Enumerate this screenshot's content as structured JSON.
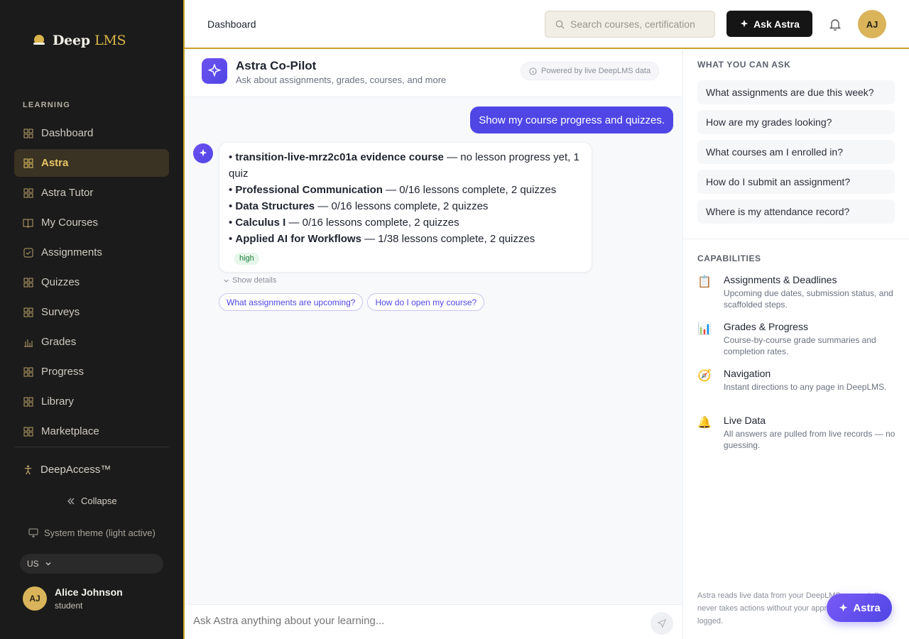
{
  "brand": {
    "name_prefix": "Deep",
    "name_suffix": "LMS"
  },
  "sidebar": {
    "section_label": "LEARNING",
    "items": [
      {
        "label": "Dashboard",
        "icon": "grid-icon",
        "active": false
      },
      {
        "label": "Astra",
        "icon": "grid-icon",
        "active": true
      },
      {
        "label": "Astra Tutor",
        "icon": "grid-icon",
        "active": false
      },
      {
        "label": "My Courses",
        "icon": "book-icon",
        "active": false
      },
      {
        "label": "Assignments",
        "icon": "check-square-icon",
        "active": false
      },
      {
        "label": "Quizzes",
        "icon": "grid-icon",
        "active": false
      },
      {
        "label": "Surveys",
        "icon": "grid-icon",
        "active": false
      },
      {
        "label": "Grades",
        "icon": "bar-chart-icon",
        "active": false
      },
      {
        "label": "Progress",
        "icon": "grid-icon",
        "active": false
      },
      {
        "label": "Library",
        "icon": "grid-icon",
        "active": false
      },
      {
        "label": "Marketplace",
        "icon": "grid-icon",
        "active": false
      }
    ],
    "deepaccess": "DeepAccess™",
    "collapse": "Collapse",
    "theme": "System theme (light active)",
    "locale": "US",
    "user": {
      "initials": "AJ",
      "name": "Alice Johnson",
      "role": "student"
    }
  },
  "topbar": {
    "breadcrumb": "Dashboard",
    "search_placeholder": "Search courses, certification",
    "ask_button": "Ask Astra",
    "user_initials": "AJ"
  },
  "chat": {
    "title": "Astra Co-Pilot",
    "subtitle": "Ask about assignments, grades, courses, and more",
    "powered": "Powered by live DeepLMS data",
    "user_message": "Show my course progress and quizzes.",
    "bot_lines": [
      {
        "name": "transition-live-mrz2c01a evidence course",
        "detail": " — no lesson progress yet, 1 quiz"
      },
      {
        "name": "Professional Communication",
        "detail": " — 0/16 lessons complete, 2 quizzes"
      },
      {
        "name": "Data Structures",
        "detail": " — 0/16 lessons complete, 2 quizzes"
      },
      {
        "name": "Calculus I",
        "detail": " — 0/16 lessons complete, 2 quizzes"
      },
      {
        "name": "Applied AI for Workflows",
        "detail": " — 1/38 lessons complete, 2 quizzes"
      }
    ],
    "confidence_tag": "high",
    "show_details": "Show details",
    "chips": [
      "What assignments are upcoming?",
      "How do I open my course?"
    ],
    "composer_placeholder": "Ask Astra anything about your learning..."
  },
  "right_panel": {
    "ask_heading": "WHAT YOU CAN ASK",
    "suggestions": [
      "What assignments are due this week?",
      "How are my grades looking?",
      "What courses am I enrolled in?",
      "How do I submit an assignment?",
      "Where is my attendance record?"
    ],
    "capabilities_heading": "CAPABILITIES",
    "capabilities": [
      {
        "icon": "clipboard-icon",
        "glyph": "📋",
        "title": "Assignments & Deadlines",
        "desc": "Upcoming due dates, submission status, and scaffolded steps."
      },
      {
        "icon": "chart-icon",
        "glyph": "📊",
        "title": "Grades & Progress",
        "desc": "Course-by-course grade summaries and completion rates."
      },
      {
        "icon": "compass-icon",
        "glyph": "🧭",
        "title": "Navigation",
        "desc": "Instant directions to any page in DeepLMS."
      },
      {
        "icon": "bell-icon",
        "glyph": "🔔",
        "title": "Live Data",
        "desc": "All answers are pulled from live records — no guessing."
      }
    ],
    "footnote": "Astra reads live data from your DeepLMS account. It never takes actions without your approval. All activity is logged.",
    "fab_label": "Astra"
  },
  "colors": {
    "accent": "#4f46e5",
    "gold": "#c9a227",
    "sidebar_bg": "#1b1b1b"
  }
}
